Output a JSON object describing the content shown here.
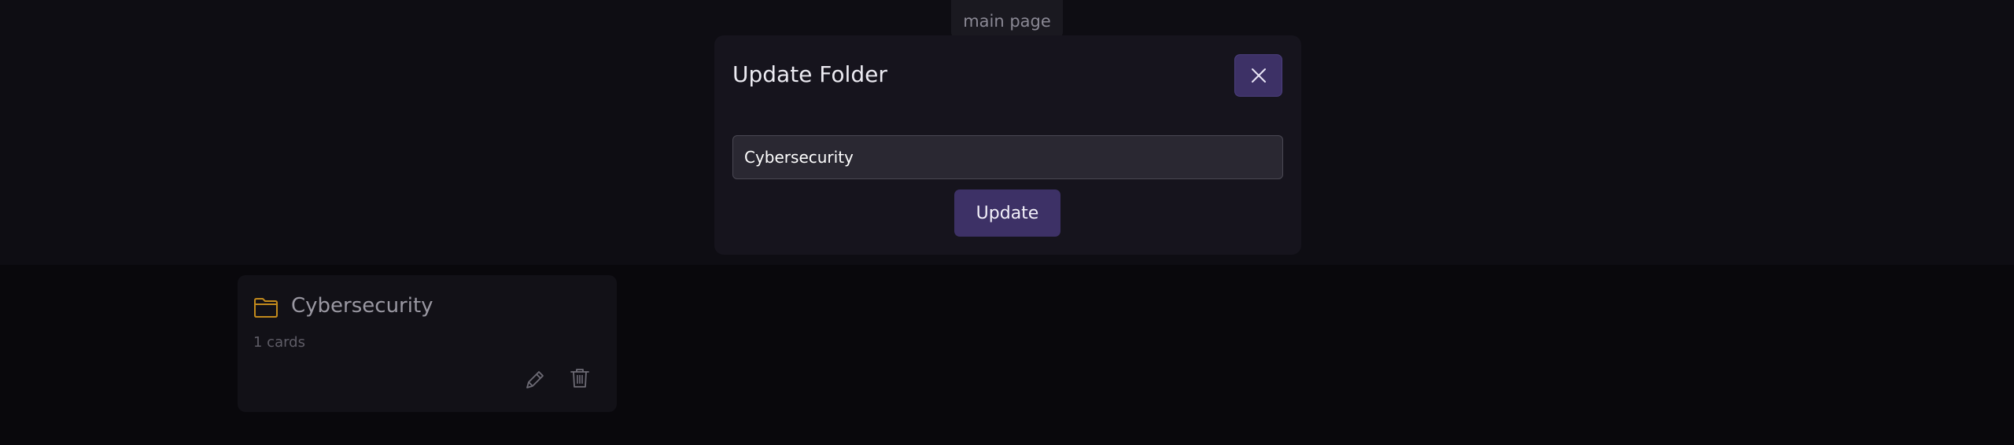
{
  "nav": {
    "tab_label": "main page"
  },
  "modal": {
    "title": "Update Folder",
    "close_icon": "close-icon",
    "input_value": "Cybersecurity",
    "update_label": "Update"
  },
  "folders": [
    {
      "name": "Cybersecurity",
      "count_text": "1 cards",
      "icon": "folder-icon",
      "edit_icon": "pencil-icon",
      "delete_icon": "trash-icon"
    }
  ],
  "colors": {
    "background": "#09080c",
    "accent": "#3d3166",
    "folder_icon": "#c28a1c"
  }
}
